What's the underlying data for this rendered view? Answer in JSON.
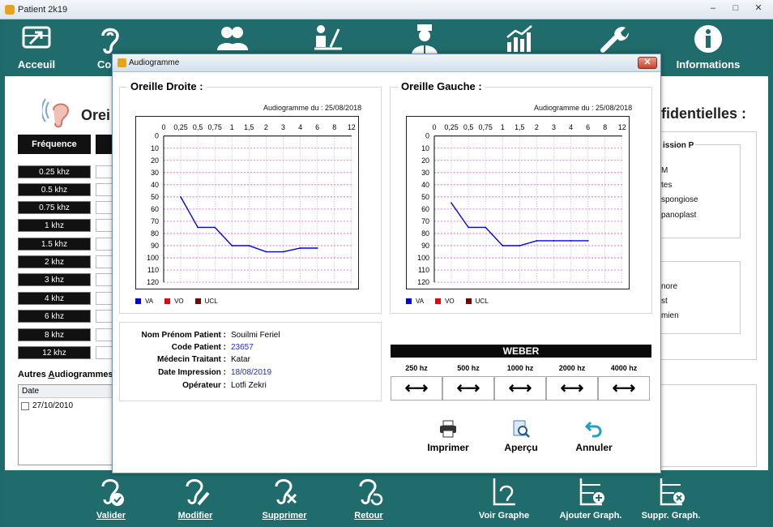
{
  "window": {
    "title": "Patient 2k19",
    "minimize": "–",
    "maximize": "□",
    "close": "✕"
  },
  "topnav": [
    {
      "id": "accueil",
      "label": "Acceuil"
    },
    {
      "id": "consultation",
      "label": "Con"
    },
    {
      "id": "patients",
      "label": ""
    },
    {
      "id": "bureau",
      "label": ""
    },
    {
      "id": "medecin",
      "label": ""
    },
    {
      "id": "stats",
      "label": ""
    },
    {
      "id": "outils",
      "label": ""
    },
    {
      "id": "informations",
      "label": "Informations"
    }
  ],
  "background": {
    "left_title": "Orei",
    "freq_header": "Fréquence",
    "frequencies": [
      "0.25 khz",
      "0.5 khz",
      "0.75 khz",
      "1 khz",
      "1.5 khz",
      "2 khz",
      "3 khz",
      "4 khz",
      "6 khz",
      "8 khz",
      "12 khz"
    ],
    "autres_label_pre": "Autres ",
    "autres_label_ul": "A",
    "autres_label_post": "udiogrammes",
    "list_header": "Date",
    "list_rows": [
      "27/10/2010"
    ],
    "right_title": "fidentielles :",
    "right_box1_title": "ission P",
    "right_box1_items": [
      "M",
      "tes",
      "spongiose",
      "panoplast"
    ],
    "right_box2_items": [
      "nore",
      "st",
      "mien"
    ]
  },
  "dialog": {
    "title": "Audiogramme",
    "close": "✕",
    "right_ear_title": "Oreille Droite :",
    "left_ear_title": "Oreille Gauche :",
    "date_label": "Audiogramme du : 25/08/2018",
    "legend": [
      {
        "name": "VA",
        "color": "#0000ee"
      },
      {
        "name": "VO",
        "color": "#ee0000"
      },
      {
        "name": "UCL",
        "color": "#7a0000"
      }
    ],
    "info": [
      {
        "label": "Nom Prénom Patient :",
        "value": "Souilmi Feriel",
        "blue": false
      },
      {
        "label": "Code Patient :",
        "value": "23657",
        "blue": true
      },
      {
        "label": "Médecin Traitant :",
        "value": "Katar",
        "blue": false
      },
      {
        "label": "Date Impression :",
        "value": "18/08/2019",
        "blue": true
      },
      {
        "label": "Opérateur :",
        "value": "Lotfi Zekri",
        "blue": false
      }
    ],
    "weber": {
      "title": "WEBER",
      "freqs": [
        "250 hz",
        "500 hz",
        "1000 hz",
        "2000 hz",
        "4000 hz"
      ],
      "arrow": "⟷"
    },
    "actions": [
      {
        "id": "imprimer",
        "label": "Imprimer"
      },
      {
        "id": "apercu",
        "label": "Aperçu"
      },
      {
        "id": "annuler",
        "label": "Annuler"
      }
    ]
  },
  "bottombar": [
    {
      "id": "valider",
      "label": "Valider",
      "underline": true
    },
    {
      "id": "modifier",
      "label": "Modifier",
      "underline": true
    },
    {
      "id": "supprimer",
      "label": "Supprimer",
      "underline": true
    },
    {
      "id": "retour",
      "label": "Retour",
      "underline": true
    },
    {
      "id": "voir-graphe",
      "label": "Voir Graphe",
      "underline": false
    },
    {
      "id": "ajouter-graph",
      "label": "Ajouter Graph.",
      "underline": false
    },
    {
      "id": "suppr-graph",
      "label": "Suppr. Graph.",
      "underline": false
    }
  ],
  "chart_data": [
    {
      "type": "line",
      "title": "Oreille Droite :",
      "subtitle": "Audiogramme du : 25/08/2018",
      "x_ticks": [
        "0",
        "0,25",
        "0,5",
        "0,75",
        "1",
        "1,5",
        "2",
        "3",
        "4",
        "6",
        "8",
        "12"
      ],
      "y_ticks": [
        0,
        10,
        20,
        30,
        40,
        50,
        60,
        70,
        80,
        90,
        100,
        110,
        120
      ],
      "ylim": [
        0,
        120
      ],
      "y_inverted": true,
      "grid": true,
      "legend": [
        "VA",
        "VO",
        "UCL"
      ],
      "series": [
        {
          "name": "VA",
          "color": "#0000ee",
          "x": [
            "0,25",
            "0,5",
            "0,75",
            "1",
            "1,5",
            "2",
            "3",
            "4",
            "6"
          ],
          "values": [
            50,
            75,
            75,
            90,
            90,
            95,
            95,
            92,
            92
          ]
        }
      ]
    },
    {
      "type": "line",
      "title": "Oreille Gauche :",
      "subtitle": "Audiogramme du : 25/08/2018",
      "x_ticks": [
        "0",
        "0,25",
        "0,5",
        "0,75",
        "1",
        "1,5",
        "2",
        "3",
        "4",
        "6",
        "8",
        "12"
      ],
      "y_ticks": [
        0,
        10,
        20,
        30,
        40,
        50,
        60,
        70,
        80,
        90,
        100,
        110,
        120
      ],
      "ylim": [
        0,
        120
      ],
      "y_inverted": true,
      "grid": true,
      "legend": [
        "VA",
        "VO",
        "UCL"
      ],
      "series": [
        {
          "name": "VA",
          "color": "#0000ee",
          "x": [
            "0,25",
            "0,5",
            "0,75",
            "1",
            "1,5",
            "2",
            "3",
            "4",
            "6"
          ],
          "values": [
            55,
            75,
            75,
            90,
            90,
            86,
            86,
            86,
            86
          ]
        }
      ]
    }
  ]
}
